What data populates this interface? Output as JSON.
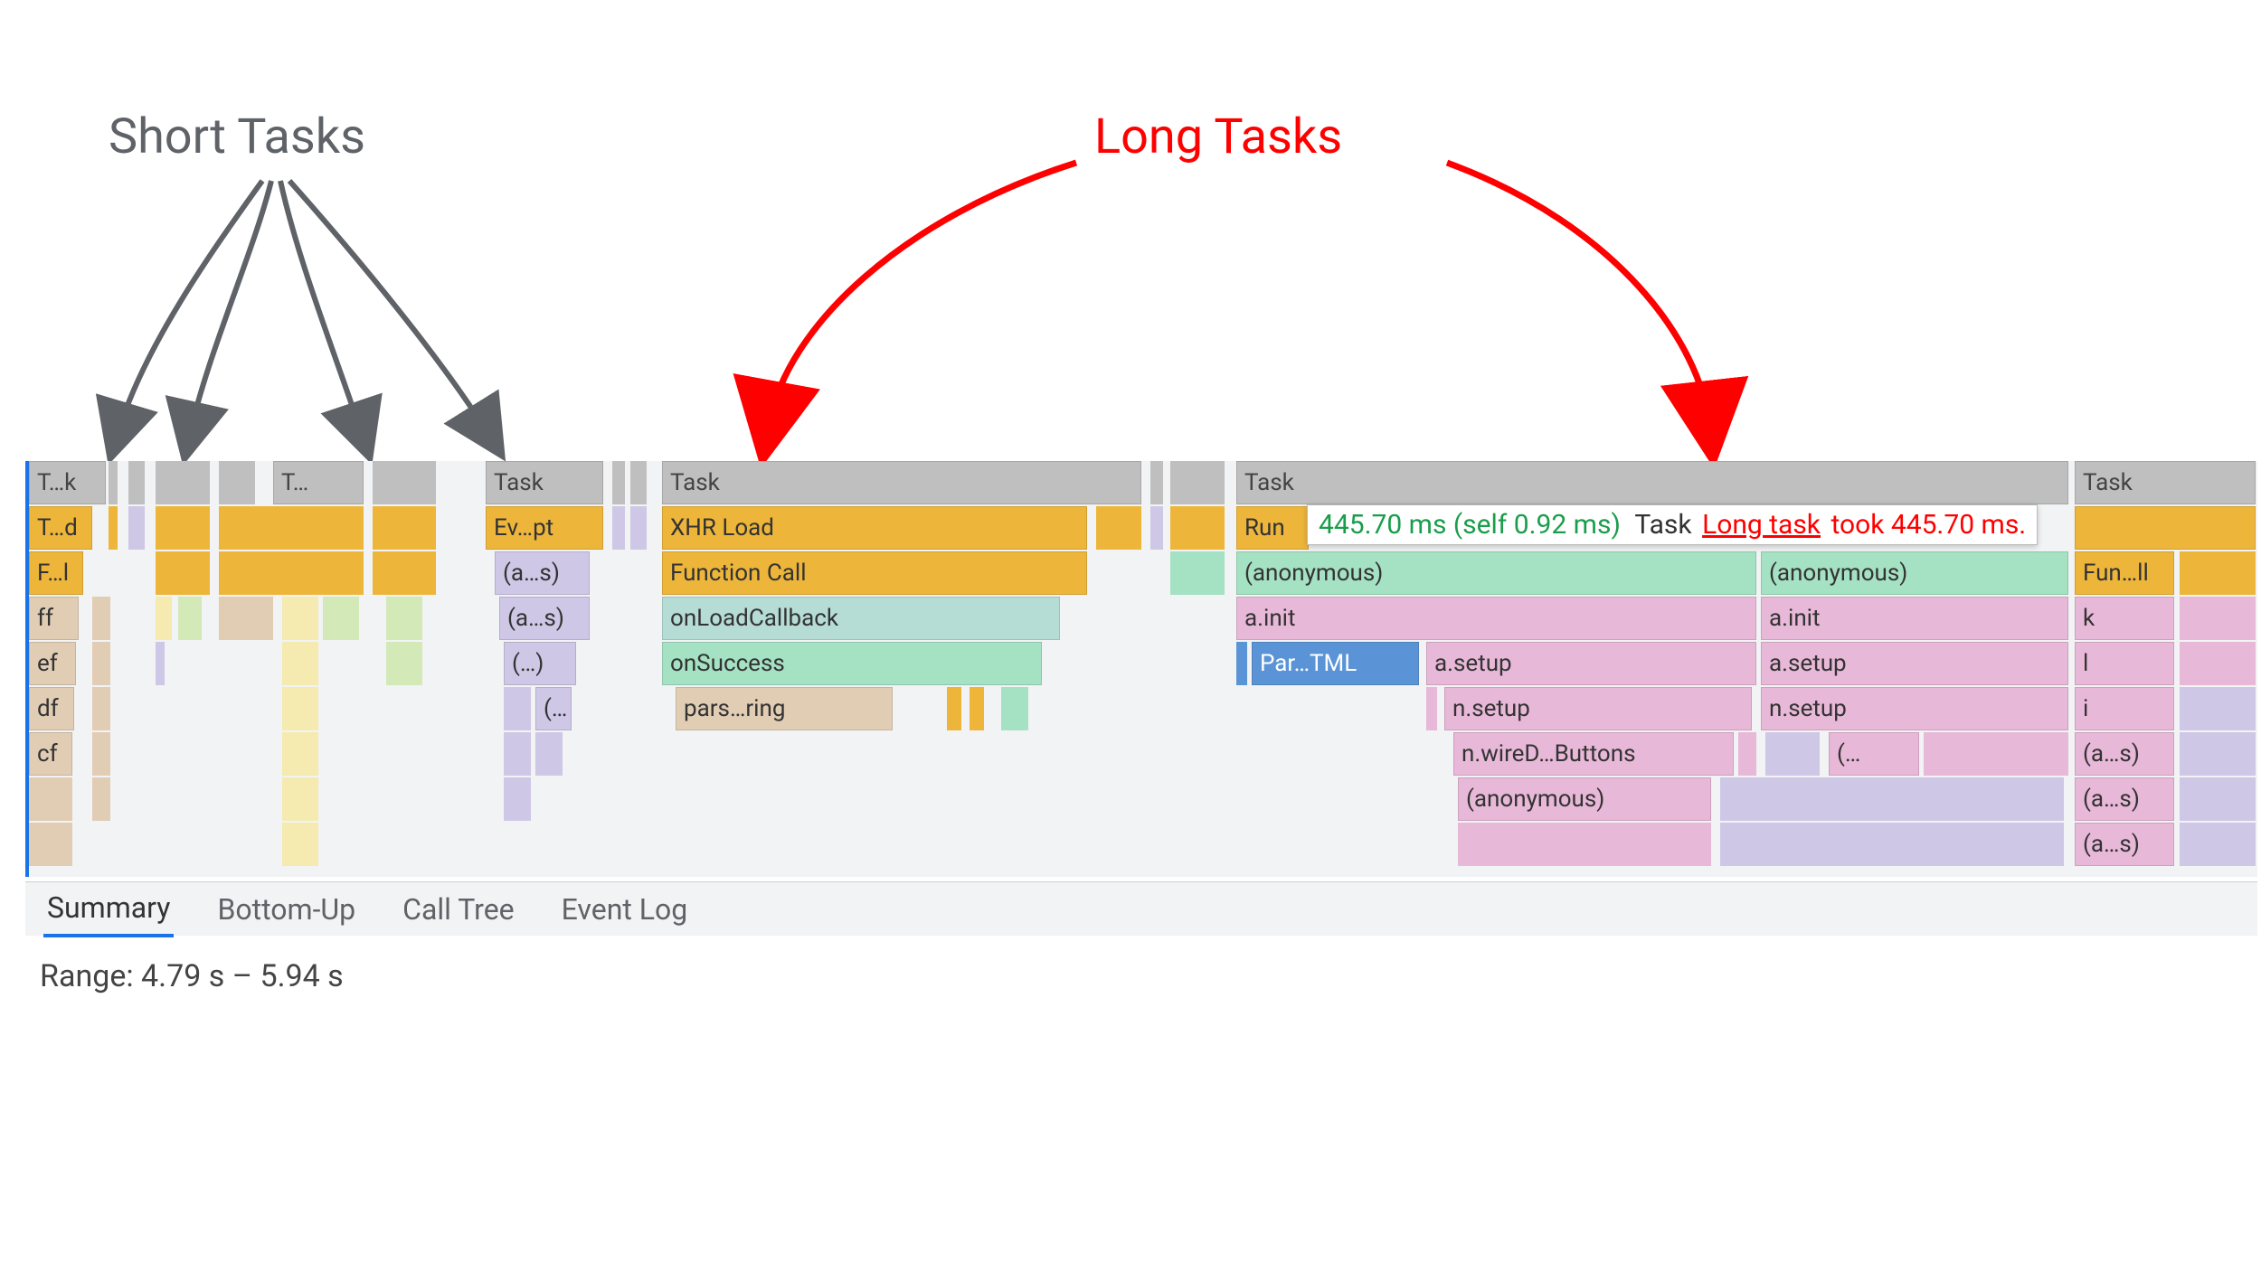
{
  "annotations": {
    "short_tasks": "Short Tasks",
    "long_tasks": "Long Tasks"
  },
  "tooltip": {
    "timing": "445.70 ms (self 0.92 ms)",
    "label": "Task",
    "link": "Long task",
    "tail": "took 445.70 ms."
  },
  "tabs": {
    "items": [
      "Summary",
      "Bottom-Up",
      "Call Tree",
      "Event Log"
    ],
    "active": 0
  },
  "range": "Range: 4.79 s – 5.94 s",
  "flame": {
    "row0": {
      "c0": "T…k",
      "c1": "T…",
      "c2": "Task",
      "c3": "Task",
      "c4": "Task",
      "c5": "Task"
    },
    "row1": {
      "c0": "T…d",
      "c1": "Ev…pt",
      "c2": "XHR Load",
      "c3": "Run"
    },
    "row2": {
      "c0": "F…l",
      "c1": "(a…s)",
      "c2": "Function Call",
      "c3": "(anonymous)",
      "c4": "(anonymous)",
      "c5": "Fun…ll"
    },
    "row3": {
      "c0": "ff",
      "c1": "(a…s)",
      "c2": "onLoadCallback",
      "c3": "a.init",
      "c4": "a.init",
      "c5": "k"
    },
    "row4": {
      "c0": "ef",
      "c1": "(…)",
      "c2": "onSuccess",
      "c3": "Par…TML",
      "c4": "a.setup",
      "c5": "a.setup",
      "c6": "l"
    },
    "row5": {
      "c0": "df",
      "c1": "(…",
      "c2": "pars…ring",
      "c3": "n.setup",
      "c4": "n.setup",
      "c5": "i"
    },
    "row6": {
      "c0": "cf",
      "c1": "n.wireD…Buttons",
      "c2": "(…",
      "c3": "(a…s)"
    },
    "row7": {
      "c0": "(anonymous)",
      "c1": "(a…s)"
    },
    "row8": {
      "c0": "(a…s)"
    }
  }
}
